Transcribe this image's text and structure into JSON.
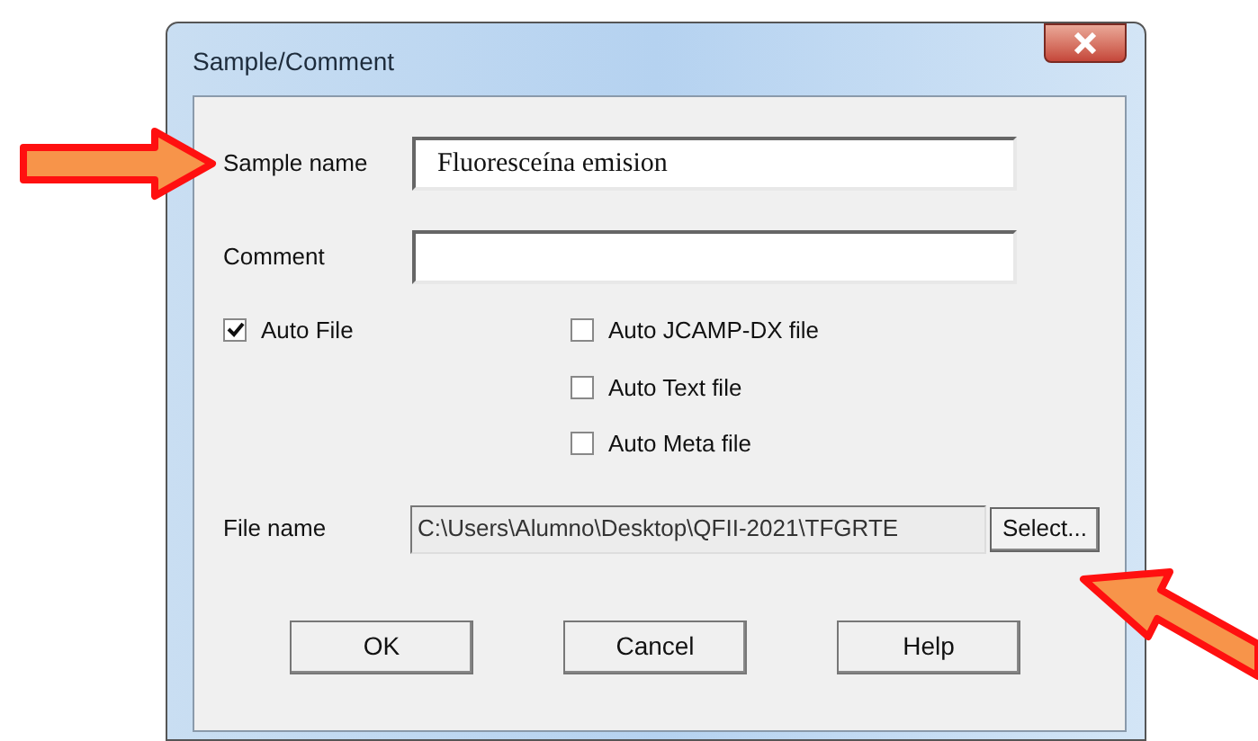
{
  "window": {
    "title": "Sample/Comment"
  },
  "fields": [
    {
      "label": "Sample name",
      "value": "Fluoresceína emision",
      "serif": true
    },
    {
      "label": "Comment"
    }
  ],
  "auto_file": {
    "label": "Auto File",
    "checked": true
  },
  "options": [
    {
      "label": "Auto JCAMP-DX file",
      "checked": false
    },
    {
      "label": "Auto Text file",
      "checked": false
    },
    {
      "label": "Auto Meta file",
      "checked": false
    }
  ],
  "file_name": {
    "label": "File name",
    "value": "C:\\Users\\Alumno\\Desktop\\QFII-2021\\TFGRTE",
    "button": "Select..."
  },
  "buttons": [
    "OK",
    "Cancel",
    "Help"
  ]
}
